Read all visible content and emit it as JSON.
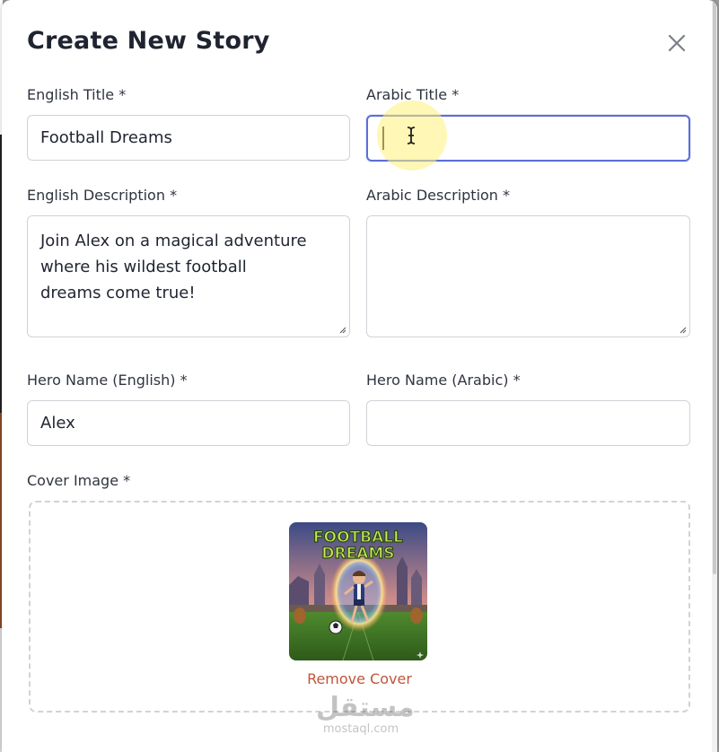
{
  "modal": {
    "title": "Create New Story"
  },
  "form": {
    "english_title": {
      "label": "English Title *",
      "value": "Football Dreams"
    },
    "arabic_title": {
      "label": "Arabic Title *",
      "value": ""
    },
    "english_description": {
      "label": "English Description *",
      "value": "Join Alex on a magical adventure where his wildest football dreams come true!"
    },
    "arabic_description": {
      "label": "Arabic Description *",
      "value": ""
    },
    "hero_name_english": {
      "label": "Hero Name (English) *",
      "value": "Alex"
    },
    "hero_name_arabic": {
      "label": "Hero Name (Arabic) *",
      "value": ""
    },
    "cover_image": {
      "label": "Cover Image *",
      "image_title_line1": "FOOTBALL",
      "image_title_line2": "DREAMS",
      "remove_label": "Remove Cover"
    }
  },
  "watermark": {
    "arabic": "مستقل",
    "latin": "mostaql.com"
  },
  "colors": {
    "accent": "#5b6fd6",
    "danger": "#c0553a",
    "title": "#1f2430"
  },
  "icons": {
    "close": "close-icon",
    "cursor": "text-cursor-icon"
  }
}
